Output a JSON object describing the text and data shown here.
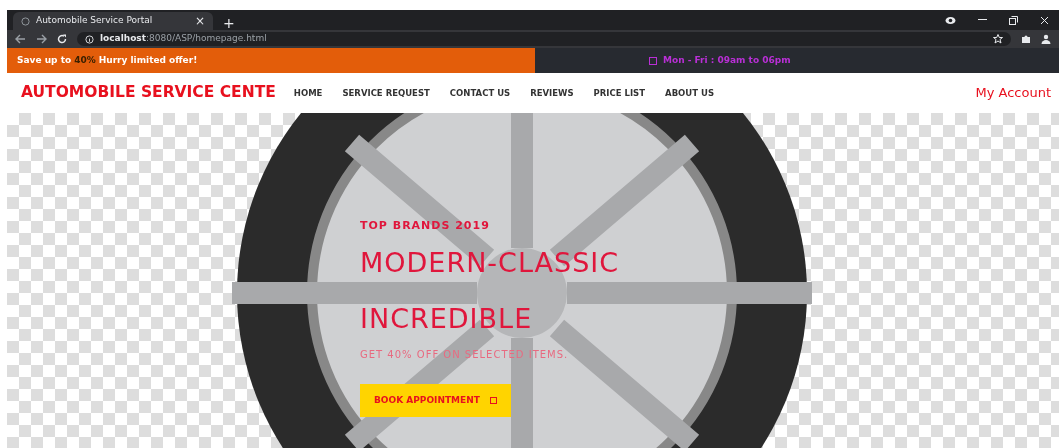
{
  "browser": {
    "tab_title": "Automobile Service Portal",
    "tab_close": "×",
    "new_tab": "+",
    "url_host": "localhost",
    "url_rest": ":8080/ASP/homepage.html"
  },
  "top_bar": {
    "offer_before": "Save up to",
    "offer_highlight": "40%",
    "offer_after": "Hurry limited offer!",
    "hours": "Mon - Fri : 09am to 06pm"
  },
  "navbar": {
    "brand": "AUTOMOBILE SERVICE CENTE",
    "links": [
      {
        "label": "HOME"
      },
      {
        "label": "SERVICE REQUEST"
      },
      {
        "label": "CONTACT US"
      },
      {
        "label": "REVIEWS"
      },
      {
        "label": "PRICE LIST"
      },
      {
        "label": "ABOUT US"
      }
    ],
    "account": "My Account"
  },
  "hero": {
    "eyebrow": "TOP BRANDS 2019",
    "headline_1": "MODERN-CLASSIC",
    "headline_2": "INCREDIBLE",
    "subtitle": "GET 40% OFF ON SELECTED ITEMS.",
    "button": "BOOK APPOINTMENT"
  }
}
